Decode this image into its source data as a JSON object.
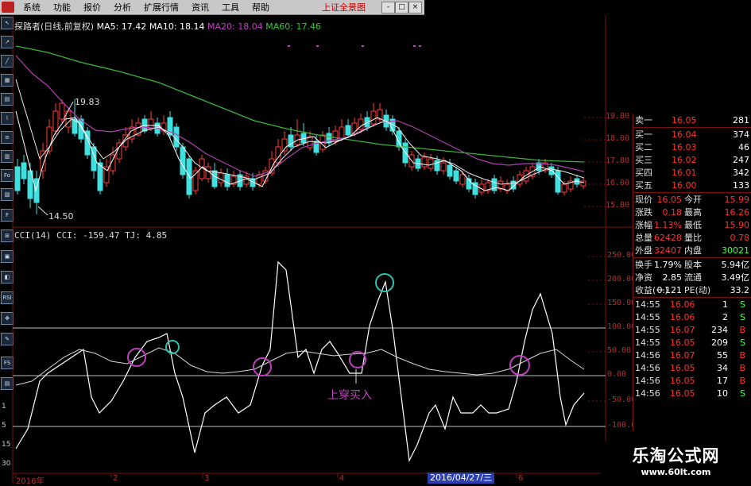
{
  "menubar": {
    "items": [
      "系统",
      "功能",
      "报价",
      "分析",
      "扩展行情",
      "资讯",
      "工具",
      "帮助"
    ],
    "window_title": "上证全景图",
    "buttons": [
      "-",
      "□",
      "×"
    ]
  },
  "header": {
    "title": "探路者(日线,前复权)",
    "ma5": "MA5: 17.42",
    "ma10": "MA10: 18.14",
    "ma20": "MA20: 18.04",
    "ma60": "MA60: 17.46",
    "colors": {
      "ma5": "#ffffff",
      "ma10": "#ffffff",
      "ma20": "#c040c0",
      "ma60": "#40c040"
    }
  },
  "price_chart": {
    "y_ticks": [
      "19.00",
      "18.00",
      "17.00",
      "16.00",
      "15.00"
    ],
    "high_label": "19.83",
    "low_label": "14.50"
  },
  "cci_header": {
    "name": "CCI(14)",
    "cci": "CCI: -159.47",
    "tj": "TJ: 4.85"
  },
  "cci_chart": {
    "y_ticks": [
      "250.00",
      "200.00",
      "150.00",
      "100.00",
      "50.00",
      "0.00",
      "-50.00",
      "-100.00"
    ],
    "annotation": "上穿买入"
  },
  "x_axis": {
    "labels": [
      "2016年",
      "2",
      "3",
      "4",
      "6"
    ],
    "current_date": "2016/04/27/三"
  },
  "toolbar": {
    "numbers": [
      "1",
      "5",
      "15",
      "30"
    ]
  },
  "quote_panel": {
    "orderbook": [
      {
        "label": "卖一",
        "price": "16.05",
        "vol": "281"
      },
      {
        "label": "买一",
        "price": "16.04",
        "vol": "374"
      },
      {
        "label": "买二",
        "price": "16.03",
        "vol": "46"
      },
      {
        "label": "买三",
        "price": "16.02",
        "vol": "247"
      },
      {
        "label": "买四",
        "price": "16.01",
        "vol": "342"
      },
      {
        "label": "买五",
        "price": "16.00",
        "vol": "133"
      }
    ],
    "stats": [
      {
        "l1": "现价",
        "v1": "16.05",
        "l2": "今开",
        "v2": "15.99"
      },
      {
        "l1": "涨跌",
        "v1": "0.18",
        "l2": "最高",
        "v2": "16.26"
      },
      {
        "l1": "涨幅",
        "v1": "1.13%",
        "l2": "最低",
        "v2": "15.90"
      },
      {
        "l1": "总量",
        "v1": "62428",
        "l2": "量比",
        "v2": "0.78"
      },
      {
        "l1": "外盘",
        "v1": "32407",
        "l2": "内盘",
        "v2": "30021"
      }
    ],
    "fund": [
      {
        "l1": "换手",
        "v1": "1.79%",
        "l2": "股本",
        "v2": "5.94亿"
      },
      {
        "l1": "净资",
        "v1": "2.85",
        "l2": "流通",
        "v2": "3.49亿"
      },
      {
        "l1": "收益(一)",
        "v1": "0.121",
        "l2": "PE(动)",
        "v2": "33.2"
      }
    ],
    "trades": [
      {
        "t": "14:55",
        "p": "16.06",
        "v": "1",
        "s": "S"
      },
      {
        "t": "14:55",
        "p": "16.06",
        "v": "2",
        "s": "S"
      },
      {
        "t": "14:55",
        "p": "16.07",
        "v": "234",
        "s": "B"
      },
      {
        "t": "14:55",
        "p": "16.05",
        "v": "209",
        "s": "S"
      },
      {
        "t": "14:56",
        "p": "16.07",
        "v": "55",
        "s": "B"
      },
      {
        "t": "14:56",
        "p": "16.05",
        "v": "34",
        "s": "B"
      },
      {
        "t": "14:56",
        "p": "16.05",
        "v": "17",
        "s": "B"
      },
      {
        "t": "14:56",
        "p": "16.05",
        "v": "10",
        "s": "S"
      }
    ],
    "colors": {
      "up": "#ff3030",
      "down": "#40ff40",
      "neutral": "#ffffff",
      "label": "#e0e0e0"
    }
  },
  "watermark": {
    "title": "乐淘公式网",
    "url": "www.60lt.com"
  }
}
